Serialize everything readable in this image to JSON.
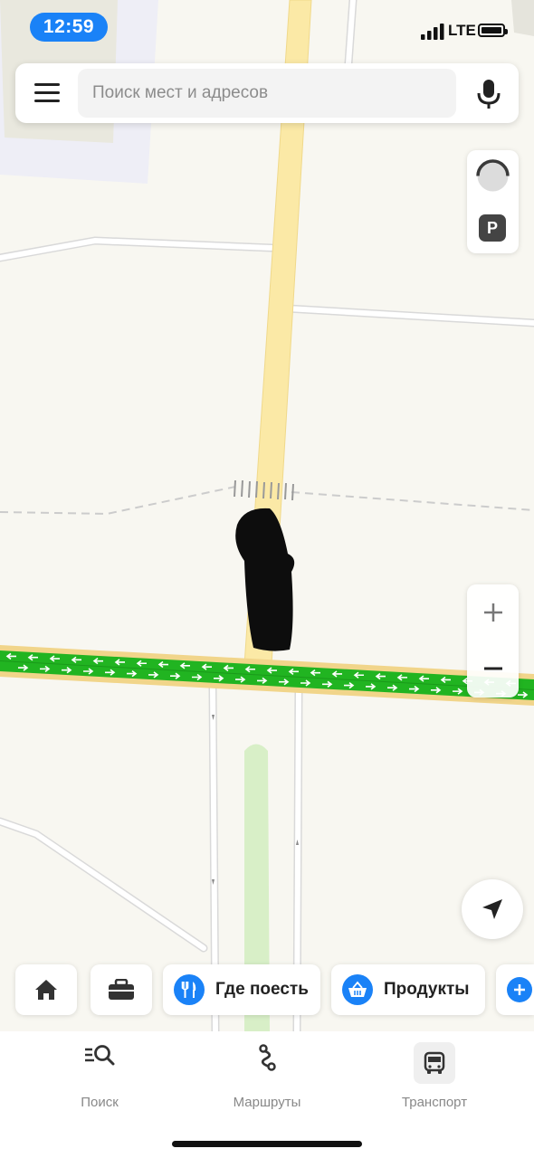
{
  "status_bar": {
    "time": "12:59",
    "network": "LTE"
  },
  "search": {
    "placeholder": "Поиск мест и адресов"
  },
  "map_controls": {
    "parking_label": "P",
    "zoom_in_icon": "plus-icon",
    "zoom_out_icon": "minus-icon",
    "locate_icon": "navigation-arrow-icon",
    "traffic_icon": "traffic-gauge-icon"
  },
  "quick_chips": [
    {
      "icon": "home-icon",
      "label": ""
    },
    {
      "icon": "briefcase-icon",
      "label": ""
    },
    {
      "icon": "fork-knife-icon",
      "label": "Где поесть"
    },
    {
      "icon": "basket-icon",
      "label": "Продукты"
    },
    {
      "icon": "plus-icon",
      "label": ""
    }
  ],
  "tab_bar": {
    "tabs": [
      {
        "icon": "search-list-icon",
        "label": "Поиск"
      },
      {
        "icon": "route-icon",
        "label": "Маршруты"
      },
      {
        "icon": "bus-icon",
        "label": "Транспорт"
      }
    ]
  },
  "colors": {
    "accent": "#1a82f7",
    "map_background": "#f8f7f1",
    "main_road": "#fbe9a6",
    "traffic_green": "#21b421"
  }
}
